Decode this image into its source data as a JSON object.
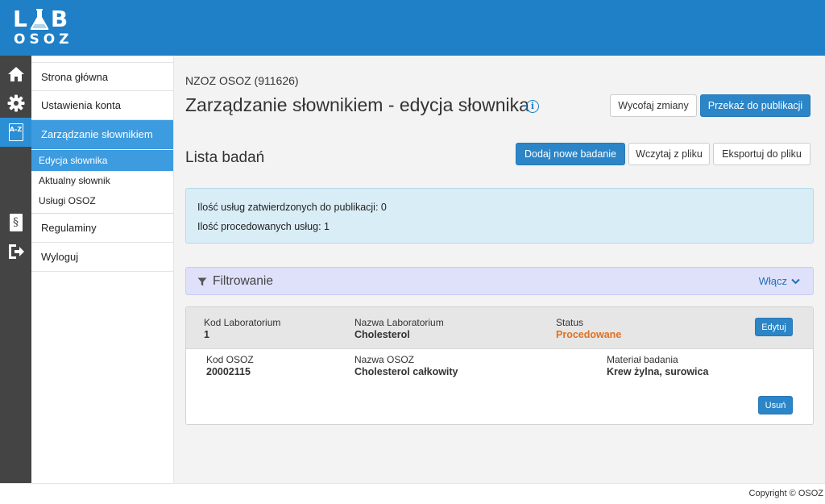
{
  "header": {
    "logo_top": "LAB",
    "logo_bottom": "OSOZ"
  },
  "rail": {
    "icons": [
      "home-icon",
      "gear-icon",
      "dictionary-az-icon",
      "regulations-section-icon",
      "logout-icon"
    ],
    "az_label": "A-Z",
    "section_symbol": "§"
  },
  "sidebar": {
    "items": [
      {
        "label": "Strona główna"
      },
      {
        "label": "Ustawienia konta"
      },
      {
        "label": "Zarządzanie słownikiem"
      },
      {
        "label": "Regulaminy"
      },
      {
        "label": "Wyloguj"
      }
    ],
    "subitems": [
      {
        "label": "Edycja słownika"
      },
      {
        "label": "Aktualny słownik"
      },
      {
        "label": "Usługi OSOZ"
      }
    ]
  },
  "main": {
    "org": "NZOZ OSOZ (911626)",
    "title": "Zarządzanie słownikiem - edycja słownika",
    "info_icon_glyph": "i",
    "buttons": {
      "revert": "Wycofaj zmiany",
      "publish": "Przekaż do publikacji",
      "add": "Dodaj nowe badanie",
      "load": "Wczytaj z pliku",
      "export": "Eksportuj do pliku"
    },
    "list_title": "Lista badań",
    "alert": {
      "approved": "Ilość usług zatwierdzonych do publikacji: 0",
      "processed": "Ilość procedowanych usług: 1"
    },
    "filter": {
      "label": "Filtrowanie",
      "toggle": "Włącz"
    },
    "record": {
      "lab_code_label": "Kod Laboratorium",
      "lab_code": "1",
      "lab_name_label": "Nazwa Laboratorium",
      "lab_name": "Cholesterol",
      "status_label": "Status",
      "status": "Procedowane",
      "edit_button": "Edytuj",
      "osoz_code_label": "Kod OSOZ",
      "osoz_code": "20002115",
      "osoz_name_label": "Nazwa OSOZ",
      "osoz_name": "Cholesterol całkowity",
      "material_label": "Materiał badania",
      "material": "Krew żylna, surowica",
      "delete_button": "Usuń"
    }
  },
  "footer": {
    "copyright": "Copyright © OSOZ"
  },
  "colors": {
    "header": "#1f80c8",
    "rail": "#444444",
    "accent": "#3d9be0",
    "primary_button": "#2b85c7",
    "status_orange": "#e07020",
    "alert_bg": "#d9edf7",
    "filter_bg": "#dfe1fb"
  }
}
